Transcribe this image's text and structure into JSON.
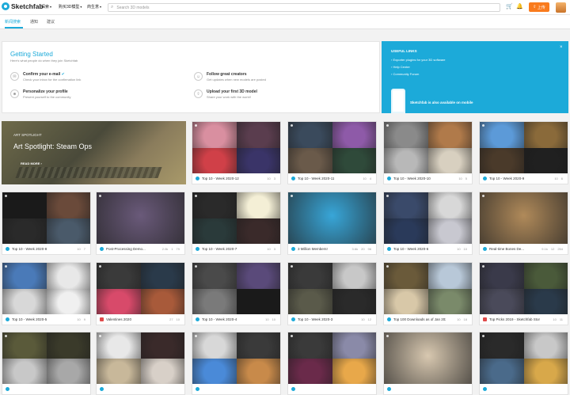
{
  "header": {
    "logo_text": "Sketchfab",
    "nav": [
      {
        "label": "探索"
      },
      {
        "label": "购买3D模型"
      },
      {
        "label": "商生意"
      }
    ],
    "search_placeholder": "Search 3D models",
    "upload_label": "上传"
  },
  "subnav": {
    "tabs": [
      {
        "label": "新闻搜索"
      },
      {
        "label": "通知"
      },
      {
        "label": "建议"
      }
    ]
  },
  "getting_started": {
    "title": "Getting Started",
    "subtitle": "Here's what people do when they join Sketchfab",
    "items": [
      {
        "title": "Confirm your e-mail",
        "desc": "Check your inbox for the confirmation link",
        "icon": "envelope-icon"
      },
      {
        "title": "Follow great creators",
        "desc": "Get updates when new models are posted",
        "icon": "follow-icon"
      },
      {
        "title": "Personalize your profile",
        "desc": "Present yourself to the community",
        "icon": "user-icon"
      },
      {
        "title": "Upload your first 3D model",
        "desc": "Share your work with the world!",
        "icon": "upload-icon"
      }
    ]
  },
  "promo": {
    "heading": "USEFUL LINKS",
    "links": [
      "Exporter plugins for your 3D software",
      "Help Center",
      "Community Forum"
    ],
    "mobile": "Sketchfab is also available on mobile",
    "close": "×"
  },
  "spotlight": {
    "tag": "ART SPOTLIGHT",
    "title": "Art Spotlight: Steam Ops",
    "more": "READ MORE ›"
  },
  "cards": [
    {
      "title": "Top 10 - Week 2020-12",
      "views": "10",
      "likes": "3",
      "icon": "blue",
      "colors": [
        "#d98fa0",
        "#5a3d4e",
        "#d04048",
        "#3a3468"
      ]
    },
    {
      "title": "Top 10 - Week 2020-11",
      "views": "10",
      "likes": "4",
      "icon": "blue",
      "colors": [
        "#3a4a5c",
        "#8e5aa8",
        "#6a5a4a",
        "#2f4a3a"
      ]
    },
    {
      "title": "Top 10 - Week 2020-10",
      "views": "10",
      "likes": "5",
      "icon": "blue",
      "colors": [
        "#8a8a8a",
        "#b07a4a",
        "#b8b8b8",
        "#d8d0c0"
      ]
    },
    {
      "title": "Top 10 - Week 2020-9",
      "views": "10",
      "likes": "6",
      "icon": "blue",
      "colors": [
        "#5c9ad8",
        "#8a6a3a",
        "#4a3a2a",
        "#202020"
      ]
    },
    {
      "title": "Top 10 - Week 2020-8",
      "views": "10",
      "likes": "7",
      "icon": "blue",
      "colors": [
        "#1a1a1a",
        "#6a4a3a",
        "#2a2a2a",
        "#4a5a6a"
      ]
    },
    {
      "title": "Post-Processing Demo...",
      "views": "2.0k",
      "downloads": "1",
      "likes": "79",
      "icon": "blue",
      "single": "#6a5a7a"
    },
    {
      "title": "Top 10 - Week 2020-7",
      "views": "10",
      "likes": "3",
      "icon": "blue",
      "colors": [
        "#2a2a2a",
        "#f4efd6",
        "#2a3a3a",
        "#3a2a2a"
      ]
    },
    {
      "title": "3 Million Members!",
      "views": "3.6k",
      "downloads": "20",
      "likes": "96",
      "icon": "blue",
      "single": "#38a6d8"
    },
    {
      "title": "Top 10 - Week 2020-6",
      "views": "10",
      "likes": "10",
      "icon": "blue",
      "colors": [
        "#3a4a6a",
        "#d8d8d8",
        "#2a3a5a",
        "#c8c8d0"
      ]
    },
    {
      "title": "Real-time Bones De...",
      "views": "9.1k",
      "downloads": "12",
      "likes": "254",
      "icon": "blue",
      "single": "#b08a5a"
    },
    {
      "title": "Top 10 - Week 2020-5",
      "views": "10",
      "likes": "9",
      "icon": "blue",
      "colors": [
        "#4a7ab8",
        "#e8e8e8",
        "#d8d8d8",
        "#f0f0f0"
      ]
    },
    {
      "title": "Valentines 2020",
      "views": "27",
      "likes": "10",
      "icon": "red",
      "colors": [
        "#3a3a3a",
        "#2a3a4a",
        "#d84a6a",
        "#a85a3a"
      ]
    },
    {
      "title": "Top 10 - Week 2020-4",
      "views": "10",
      "likes": "10",
      "icon": "blue",
      "colors": [
        "#4a4a4a",
        "#5a4a7a",
        "#7a7a7a",
        "#1a1a1a"
      ]
    },
    {
      "title": "Top 10 - Week 2020-3",
      "views": "10",
      "likes": "12",
      "icon": "blue",
      "colors": [
        "#3a3a3a",
        "#c8c8c8",
        "#5a5a4a",
        "#2a2a2a"
      ]
    },
    {
      "title": "Top 100 Downloads as of Jan 202",
      "views": "10",
      "likes": "18",
      "icon": "blue",
      "colors": [
        "#6a5a3a",
        "#b8c8d8",
        "#d8c8a8",
        "#7a8a6a"
      ]
    },
    {
      "title": "Top Picks 2019 - Sketchfab Stor",
      "views": "10",
      "likes": "11",
      "icon": "red",
      "colors": [
        "#3a3a4a",
        "#4a5a3a",
        "#4a4a5a",
        "#2a3a4a"
      ]
    },
    {
      "title": "",
      "views": "",
      "likes": "",
      "icon": "blue",
      "colors": [
        "#5a5a3a",
        "#3a3a2a",
        "#c8c8c8",
        "#a8a8a8"
      ]
    },
    {
      "title": "",
      "views": "",
      "likes": "",
      "icon": "blue",
      "colors": [
        "#e8e8e8",
        "#3a2a2a",
        "#c8b89a",
        "#d8d0c8"
      ]
    },
    {
      "title": "",
      "views": "",
      "likes": "",
      "icon": "blue",
      "colors": [
        "#d8d8d8",
        "#3a3a3a",
        "#4a8ad8",
        "#c88a4a"
      ]
    },
    {
      "title": "",
      "views": "",
      "likes": "",
      "icon": "blue",
      "colors": [
        "#3a3a3a",
        "#8a8aa8",
        "#6a2a4a",
        "#e8a84a"
      ]
    },
    {
      "title": "",
      "views": "",
      "likes": "",
      "icon": "blue",
      "single": "#d8c8b0"
    },
    {
      "title": "",
      "views": "",
      "likes": "",
      "icon": "blue",
      "colors": [
        "#2a2a2a",
        "#c8c8c8",
        "#4a6a8a",
        "#d8a84a"
      ]
    }
  ]
}
